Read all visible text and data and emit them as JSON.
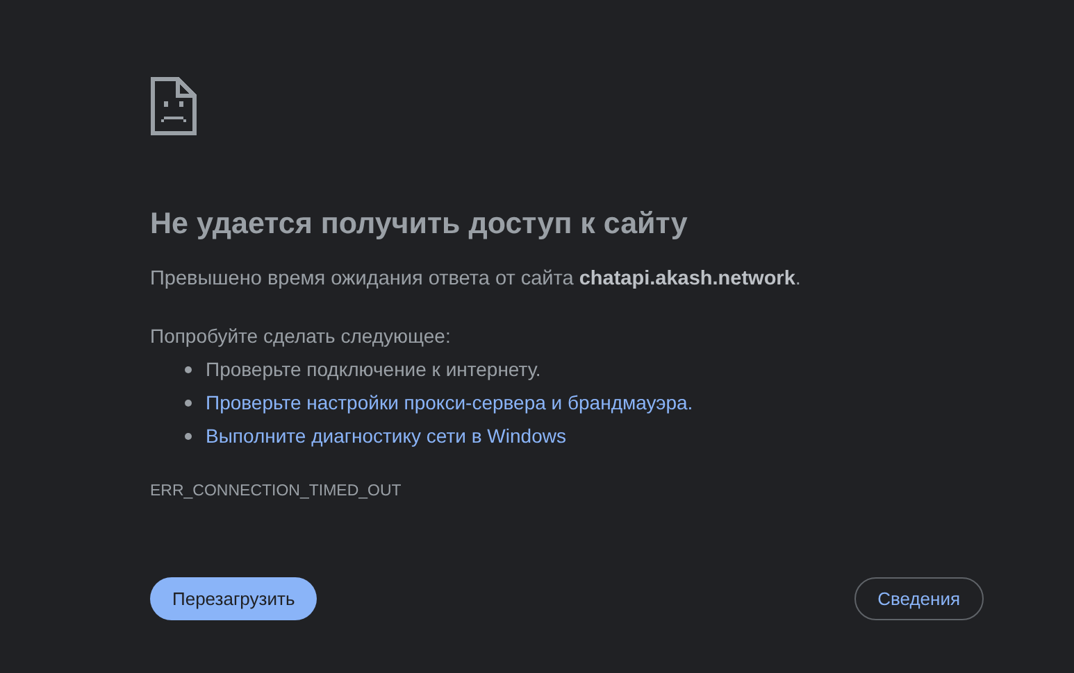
{
  "heading": "Не удается получить доступ к сайту",
  "summary": "Превышено время ожидания ответа от сайта **chatapi.akash.network**.",
  "suggestions_intro": "Попробуйте сделать следующее:",
  "suggestions": [
    {
      "kind": "text",
      "text": "Проверьте подключение к интернету."
    },
    {
      "kind": "link",
      "text": "Проверьте настройки прокси-сервера и брандмауэра."
    },
    {
      "kind": "link",
      "text": "Выполните диагностику сети в Windows"
    }
  ],
  "error_code": "ERR_CONNECTION_TIMED_OUT",
  "buttons": [
    {
      "kind": "primary",
      "label": "Перезагрузить"
    },
    {
      "kind": "secondary",
      "label": "Сведения"
    }
  ]
}
